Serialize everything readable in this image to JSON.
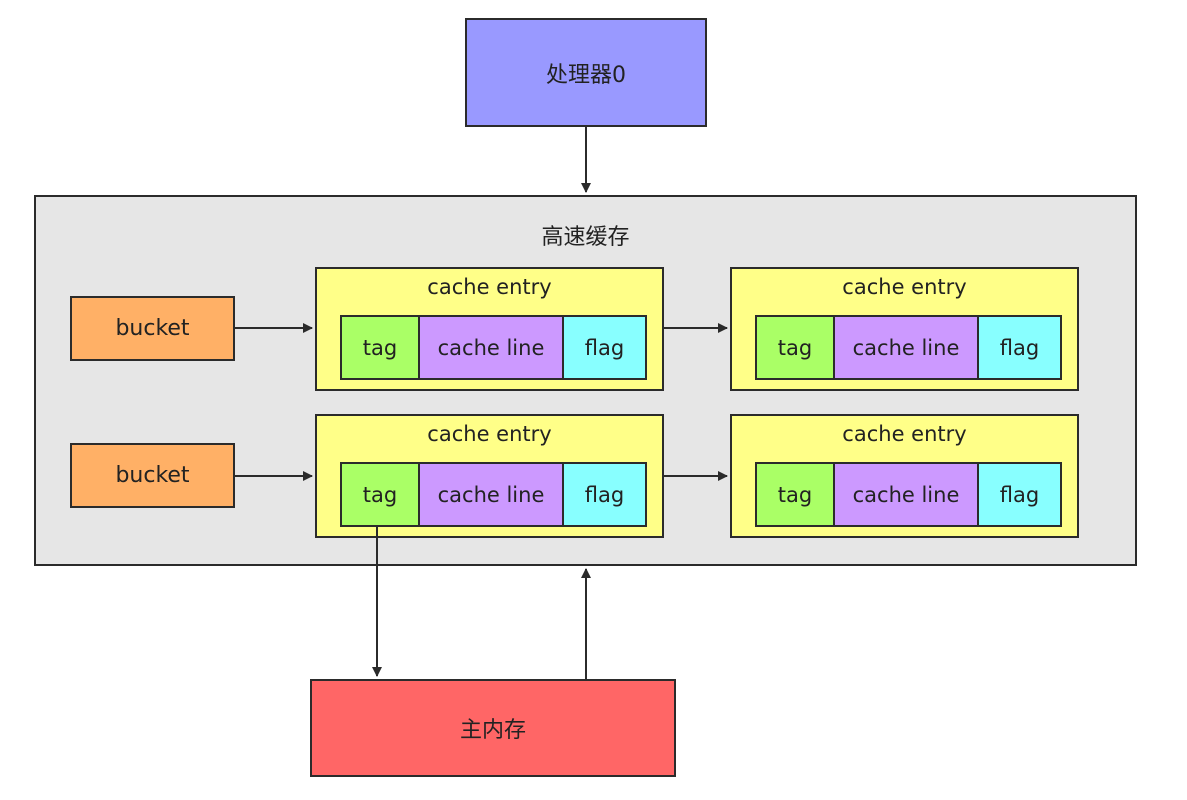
{
  "processor": {
    "label": "处理器0"
  },
  "cache": {
    "title": "高速缓存"
  },
  "buckets": [
    {
      "label": "bucket"
    },
    {
      "label": "bucket"
    }
  ],
  "entries": [
    {
      "title": "cache entry",
      "fields": {
        "tag": "tag",
        "line": "cache line",
        "flag": "flag"
      }
    },
    {
      "title": "cache entry",
      "fields": {
        "tag": "tag",
        "line": "cache line",
        "flag": "flag"
      }
    },
    {
      "title": "cache entry",
      "fields": {
        "tag": "tag",
        "line": "cache line",
        "flag": "flag"
      }
    },
    {
      "title": "cache entry",
      "fields": {
        "tag": "tag",
        "line": "cache line",
        "flag": "flag"
      }
    }
  ],
  "memory": {
    "label": "主内存"
  },
  "colors": {
    "processor": "#9999ff",
    "cache": "#e6e6e6",
    "bucket": "#ffb066",
    "entry": "#ffff88",
    "tag": "#aaff66",
    "cache_line": "#cc99ff",
    "flag": "#88ffff",
    "memory": "#ff6666"
  }
}
